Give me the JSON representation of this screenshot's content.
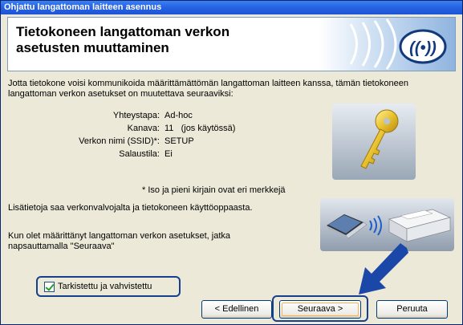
{
  "window": {
    "title": "Ohjattu langattoman laitteen asennus"
  },
  "banner": {
    "title_line1": "Tietokoneen langattoman verkon",
    "title_line2": "asetusten muuttaminen"
  },
  "intro": "Jotta tietokone voisi kommunikoida määrittämättömän langattoman laitteen kanssa, tämän tietokoneen langattoman verkon asetukset on muutettava seuraaviksi:",
  "settings": [
    {
      "label": "Yhteystapa:",
      "value": "Ad-hoc"
    },
    {
      "label": "Kanava:",
      "value": "11   (jos käytössä)"
    },
    {
      "label": "Verkon nimi (SSID)*:",
      "value": "SETUP"
    },
    {
      "label": "Salaustila:",
      "value": "Ei"
    }
  ],
  "case_note": "* Iso ja pieni kirjain ovat eri merkkejä",
  "more_info": "Lisätietoja saa verkonvalvojalta ja tietokoneen käyttöoppaasta.",
  "finish_text": "Kun olet määrittänyt langattoman verkon asetukset, jatka napsauttamalla \"Seuraava\"",
  "confirm": {
    "label": "Tarkistettu ja vahvistettu",
    "checked": true
  },
  "buttons": {
    "prev": "< Edellinen",
    "next": "Seuraava >",
    "cancel": "Peruuta"
  },
  "colors": {
    "titlebar": "#2763e4",
    "highlight_border": "#163f8c",
    "arrow": "#1a47a8"
  },
  "icons": [
    "wireless-logo-icon",
    "key-icon",
    "laptop-icon",
    "printer-icon",
    "arrow-icon"
  ]
}
